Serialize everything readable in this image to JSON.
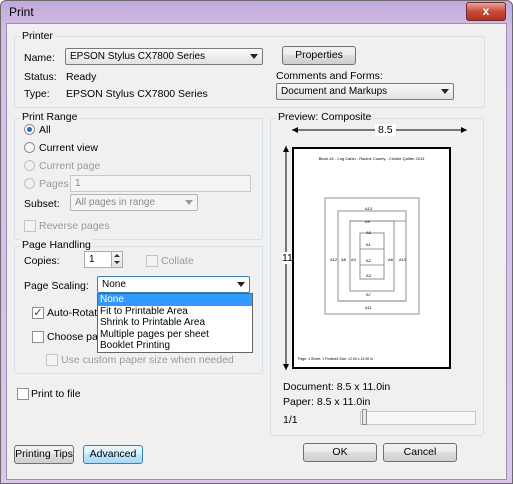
{
  "window": {
    "title": "Print",
    "close_glyph": "x"
  },
  "printer": {
    "group_label": "Printer",
    "name_label": "Name:",
    "name_value": "EPSON Stylus CX7800 Series",
    "properties_label": "Properties",
    "status_label": "Status:",
    "status_value": "Ready",
    "type_label": "Type:",
    "type_value": "EPSON Stylus CX7800 Series",
    "comments_label": "Comments and Forms:",
    "comments_value": "Document and Markups"
  },
  "print_range": {
    "group_label": "Print Range",
    "all": "All",
    "current_view": "Current view",
    "current_page": "Current page",
    "pages": "Pages",
    "pages_value": "1",
    "subset_label": "Subset:",
    "subset_value": "All pages in range",
    "reverse_pages": "Reverse pages"
  },
  "page_handling": {
    "group_label": "Page Handling",
    "copies_label": "Copies:",
    "copies_value": "1",
    "collate": "Collate",
    "scaling_label": "Page Scaling:",
    "scaling_value": "None",
    "scaling_options": [
      "None",
      "Fit to Printable Area",
      "Shrink to Printable Area",
      "Multiple pages per sheet",
      "Booklet Printing"
    ],
    "auto_rotate": "Auto-Rotate",
    "choose_paper": "Choose pape",
    "custom_paper": "Use custom paper size when needed"
  },
  "print_to_file": "Print to file",
  "preview": {
    "label": "Preview: Composite",
    "width_dim": "8.5",
    "height_dim": "11",
    "page_title": "Block #1 - Log Cabin - Racine County - Crinkle Quilter 2013",
    "block_labels": [
      "A13",
      "A9",
      "A5",
      "A1",
      "A2",
      "A3",
      "A4",
      "A6",
      "A7",
      "A8",
      "A10",
      "A11",
      "A12"
    ],
    "footer": "Page: 1   Sheet: 1 Finished Size: 12.00 x 12.00 in",
    "document_size": "Document: 8.5 x 11.0in",
    "paper_size": "Paper: 8.5 x 11.0in",
    "page_counter": "1/1"
  },
  "buttons": {
    "printing_tips": "Printing Tips",
    "advanced": "Advanced",
    "ok": "OK",
    "cancel": "Cancel"
  }
}
